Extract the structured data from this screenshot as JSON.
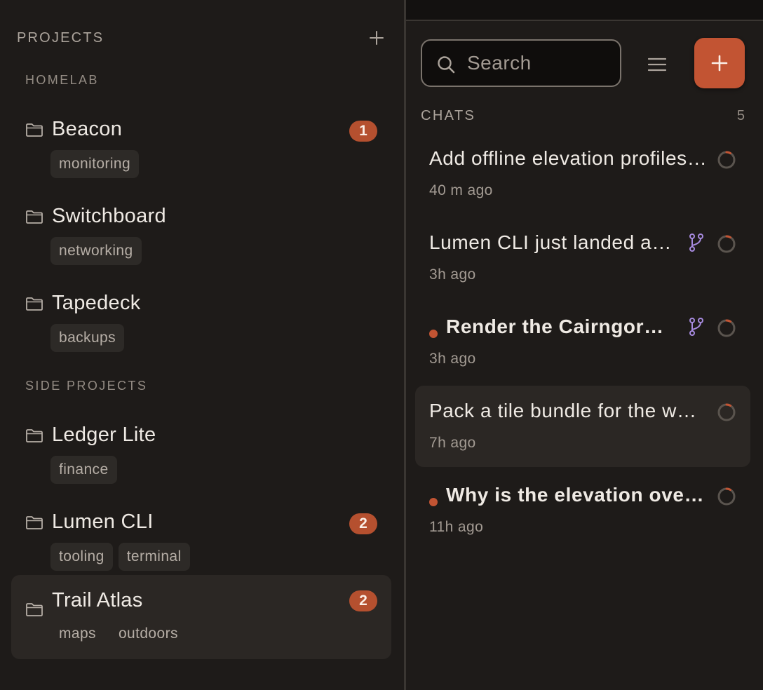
{
  "projects": {
    "title": "PROJECTS",
    "groups": [
      {
        "label": "HOMELAB",
        "items": [
          {
            "name": "Beacon",
            "badge": "1",
            "tags": [
              "monitoring"
            ]
          },
          {
            "name": "Switchboard",
            "tags": [
              "networking"
            ]
          },
          {
            "name": "Tapedeck",
            "tags": [
              "backups"
            ]
          }
        ]
      },
      {
        "label": "SIDE PROJECTS",
        "items": [
          {
            "name": "Ledger Lite",
            "tags": [
              "finance"
            ]
          },
          {
            "name": "Lumen CLI",
            "badge": "2",
            "tags": [
              "tooling",
              "terminal"
            ]
          },
          {
            "name": "Trail Atlas",
            "badge": "2",
            "tags": [
              "maps",
              "outdoors"
            ],
            "selected": true
          }
        ]
      }
    ]
  },
  "search": {
    "placeholder": "Search"
  },
  "chats": {
    "title": "CHATS",
    "count": "5",
    "items": [
      {
        "title": "Add offline elevation profiles for downloaded trails",
        "time": "40 m ago"
      },
      {
        "title": "Lumen CLI just landed a new plugin loader",
        "time": "3h ago",
        "branch": true
      },
      {
        "title": "Render the Cairngorms contour overlay",
        "time": "3h ago",
        "branch": true,
        "unread": true
      },
      {
        "title": "Pack a tile bundle for the weekend hike",
        "time": "7h ago",
        "selected": true
      },
      {
        "title": "Why is the elevation overlay misaligned",
        "time": "11h ago",
        "unread": true
      }
    ]
  },
  "colors": {
    "accent": "#c25433",
    "badge": "#b5502f",
    "branch": "#a78bdf",
    "background": "#1e1b19",
    "selected": "#2b2724"
  },
  "icons": {
    "add_project": "plus-icon",
    "project": "folder-icon",
    "search": "search-icon",
    "menu": "menu-icon",
    "new_chat": "plus-icon",
    "branch": "git-branch-icon",
    "status": "progress-ring-icon"
  }
}
